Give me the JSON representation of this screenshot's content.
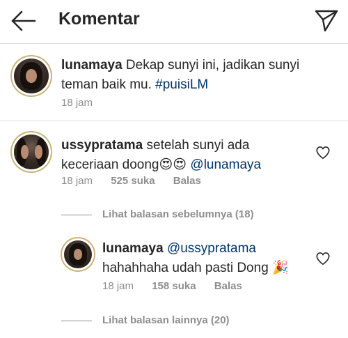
{
  "header": {
    "title": "Komentar"
  },
  "caption": {
    "username": "lunamaya",
    "text": " Dekap sunyi ini, jadikan sunyi teman baik mu. ",
    "hashtag": "#puisiLM",
    "time": "18 jam"
  },
  "comments": [
    {
      "username": "ussypratama",
      "text_line1": " setelah sunyi ada",
      "text_line2": "keceriaan doong",
      "emoji": "😍😍",
      "mention": "@lunamaya",
      "time": "18 jam",
      "likes": "525 suka",
      "reply_label": "Balas"
    }
  ],
  "view_previous": "Lihat balasan sebelumnya (18)",
  "reply": {
    "username": "lunamaya",
    "mention": "@ussypratama",
    "text_line2": "hahahhaha udah pasti Dong",
    "emoji": "🎉",
    "time": "18 jam",
    "likes": "158 suka",
    "reply_label": "Balas"
  },
  "view_more": "Lihat balasan lainnya (20)",
  "icons": {
    "back": "arrow-left-icon",
    "send": "paper-plane-icon",
    "like": "heart-outline-icon"
  }
}
